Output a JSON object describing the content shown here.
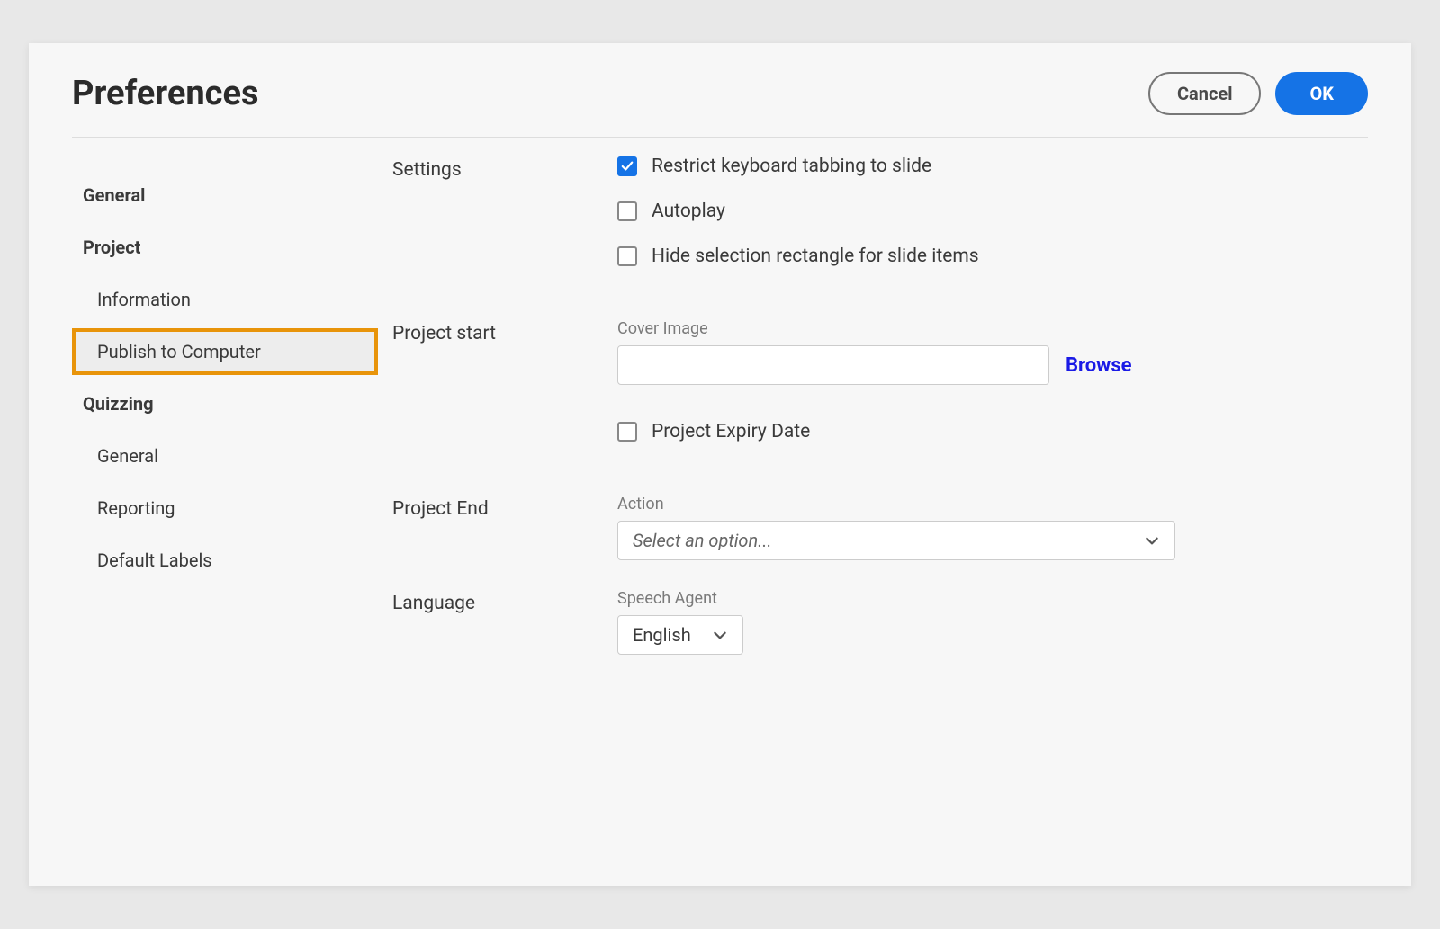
{
  "dialog": {
    "title": "Preferences",
    "cancel": "Cancel",
    "ok": "OK"
  },
  "sidebar": {
    "general": "General",
    "project": "Project",
    "information": "Information",
    "publish": "Publish to Computer",
    "quizzing": "Quizzing",
    "quiz_general": "General",
    "reporting": "Reporting",
    "default_labels": "Default Labels"
  },
  "sections": {
    "settings": {
      "label": "Settings",
      "restrict": "Restrict keyboard tabbing to slide",
      "autoplay": "Autoplay",
      "hide_rect": "Hide selection rectangle for slide items"
    },
    "project_start": {
      "label": "Project start",
      "cover_image": "Cover Image",
      "browse": "Browse",
      "expiry": "Project Expiry Date"
    },
    "project_end": {
      "label": "Project End",
      "action": "Action",
      "action_placeholder": "Select an option..."
    },
    "language": {
      "label": "Language",
      "speech_agent": "Speech Agent",
      "value": "English"
    }
  }
}
